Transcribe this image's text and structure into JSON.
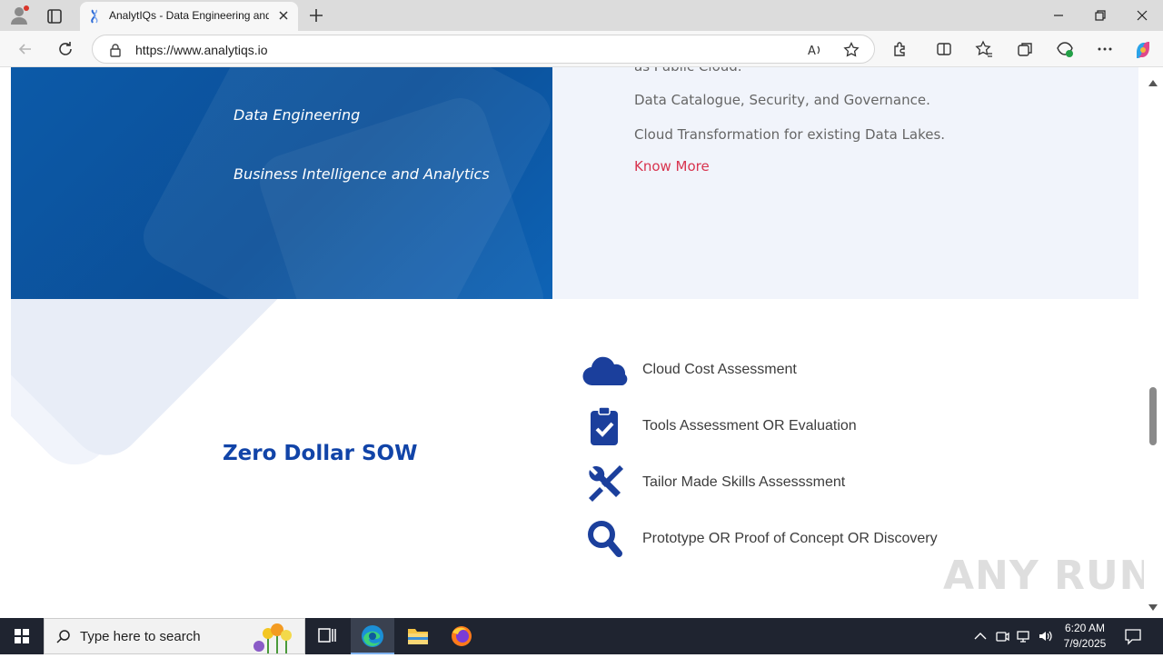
{
  "browser": {
    "tab": {
      "title": "AnalytIQs - Data Engineering and Analytics"
    },
    "address": {
      "url": "https://www.analytiqs.io"
    }
  },
  "hero": {
    "left_items": [
      "Data Engineering",
      "Business Intelligence and Analytics"
    ],
    "right_lines": [
      "as Public Cloud.",
      "Data Catalogue, Security, and Governance.",
      "Cloud Transformation for existing Data Lakes."
    ],
    "link": "Know More"
  },
  "sow": {
    "title": "Zero Dollar SOW",
    "features": [
      {
        "label": "Cloud Cost Assessment",
        "icon": "cloud-icon"
      },
      {
        "label": "Tools Assessment OR Evaluation",
        "icon": "clipboard-check-icon"
      },
      {
        "label": "Tailor Made Skills Assesssment",
        "icon": "tools-icon"
      },
      {
        "label": "Prototype OR Proof of Concept OR Discovery",
        "icon": "magnifier-icon"
      }
    ]
  },
  "watermark": "ANY RUN",
  "taskbar": {
    "search_placeholder": "Type here to search",
    "time": "6:20 AM",
    "date": "7/9/2025"
  },
  "colors": {
    "hero_blue": "#0b4f98",
    "accent_red": "#d8344f",
    "title_blue": "#1144a8",
    "icon_blue": "#1b3f9c"
  }
}
